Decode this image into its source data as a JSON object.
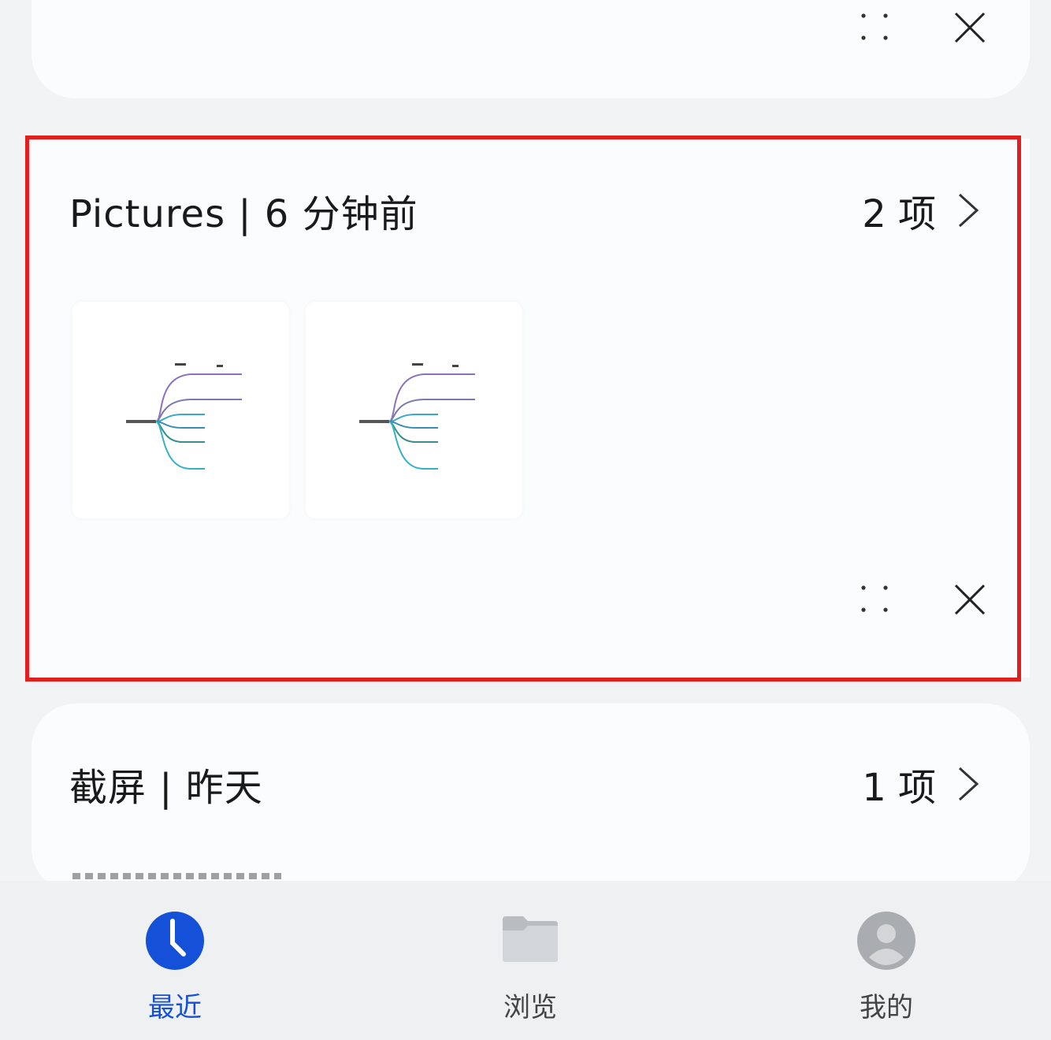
{
  "group_pictures": {
    "title": "Pictures | 6 分钟前",
    "count": "2 项"
  },
  "group_screenshots": {
    "title": "截屏 | 昨天",
    "count": "1 项"
  },
  "tabs": [
    {
      "label": "最近",
      "icon": "clock-icon",
      "active": true
    },
    {
      "label": "浏览",
      "icon": "folder-icon",
      "active": false
    },
    {
      "label": "我的",
      "icon": "user-avatar-icon",
      "active": false
    }
  ],
  "colors": {
    "accent": "#1450d8",
    "highlight": "#e11f1f",
    "background": "#f1f3f5",
    "card": "#fbfcfd"
  }
}
